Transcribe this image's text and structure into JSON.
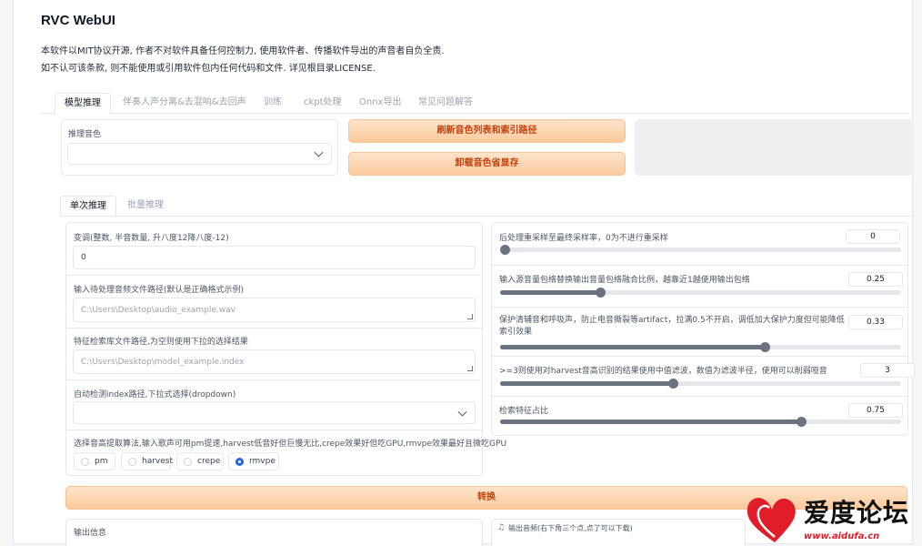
{
  "app": {
    "title": "RVC WebUI",
    "desc1": "本软件以MIT协议开源, 作者不对软件具备任何控制力, 使用软件者、传播软件导出的声音者自负全责.",
    "desc2": "如不认可该条款, 则不能使用或引用软件包内任何代码和文件. 详见根目录LICENSE."
  },
  "tabs": [
    {
      "label": "模型推理",
      "active": true
    },
    {
      "label": "伴奏人声分离&去混响&去回声",
      "active": false
    },
    {
      "label": "训练",
      "active": false
    },
    {
      "label": "ckpt处理",
      "active": false
    },
    {
      "label": "Onnx导出",
      "active": false
    },
    {
      "label": "常见问题解答",
      "active": false
    }
  ],
  "voice": {
    "label": "推理音色",
    "value": ""
  },
  "buttons": {
    "refresh": "刷新音色列表和索引路径",
    "unload": "卸载音色省显存",
    "convert": "转换"
  },
  "subtabs": [
    {
      "label": "单次推理",
      "active": true
    },
    {
      "label": "批量推理",
      "active": false
    }
  ],
  "left": {
    "transpose_label": "变调(整数, 半音数量, 升八度12降八度-12)",
    "transpose_value": "0",
    "audio_path_label": "输入待处理音频文件路径(默认是正确格式示例)",
    "audio_path_placeholder": "C:\\Users\\Desktop\\audio_example.wav",
    "index_path_label": "特征检索库文件路径,为空则使用下拉的选择结果",
    "index_path_placeholder": "C:\\Users\\Desktop\\model_example.index",
    "auto_index_label": "自动检测index路径,下拉式选择(dropdown)",
    "auto_index_value": "",
    "f0_label": "选择音高提取算法,输入歌声可用pm提速,harvest低音好但巨慢无比,crepe效果好但吃GPU,rmvpe效果最好且微吃GPU",
    "f0_options": [
      "pm",
      "harvest",
      "crepe",
      "rmvpe"
    ],
    "f0_selected": "rmvpe"
  },
  "right": {
    "sliders": [
      {
        "label": "后处理重采样至最终采样率，0为不进行重采样",
        "value": "0",
        "fraction": 0.0
      },
      {
        "label": "输入源音量包络替换输出音量包络融合比例，越靠近1越使用输出包络",
        "value": "0.25",
        "fraction": 0.25
      },
      {
        "label": "保护清辅音和呼吸声，防止电音撕裂等artifact，拉满0.5不开启，调低加大保护力度但可能降低索引效果",
        "value": "0.33",
        "fraction": 0.66
      },
      {
        "label": ">=3则使用对harvest音高识别的结果使用中值滤波，数值为滤波半径，使用可以削弱哑音",
        "value": "3",
        "fraction": 0.43
      },
      {
        "label": "检索特征占比",
        "value": "0.75",
        "fraction": 0.75
      }
    ]
  },
  "output": {
    "info_label": "输出信息",
    "audio_label": "输出音频(右下角三个点,点了可以下载)"
  },
  "watermark": {
    "text_cn": "爱度论坛",
    "text_url": "www.aidufa.cn"
  }
}
